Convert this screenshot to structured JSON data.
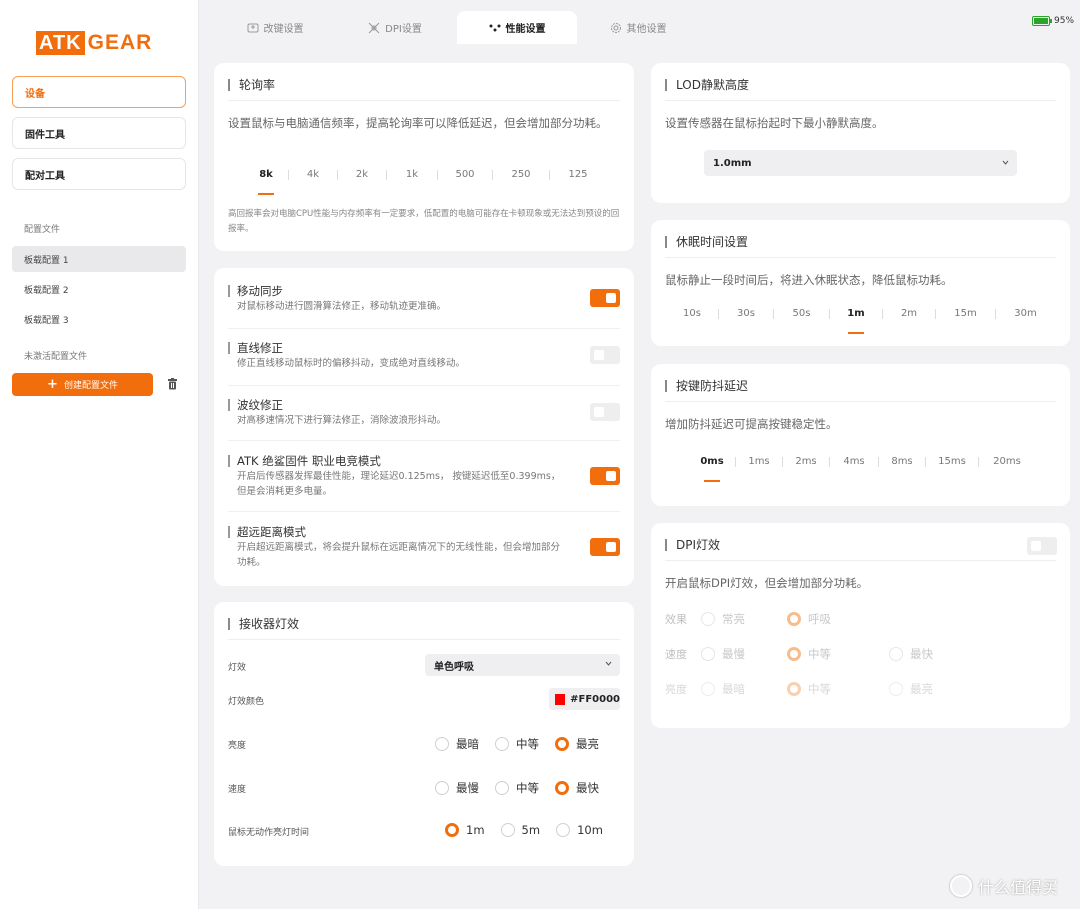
{
  "brand": {
    "logo_a": "ATK",
    "logo_b": "GEAR",
    "accent": "#f26d0c"
  },
  "sidebar": {
    "nav": [
      "设备",
      "固件工具",
      "配对工具"
    ],
    "config_section_label": "配置文件",
    "configs": [
      "板载配置 1",
      "板载配置 2",
      "板载配置 3"
    ],
    "inactive_label": "未激活配置文件",
    "create_label": "创建配置文件"
  },
  "tabs": [
    {
      "label": "改键设置",
      "icon": "keyboard-icon"
    },
    {
      "label": "DPI设置",
      "icon": "crosshair-icon"
    },
    {
      "label": "性能设置",
      "icon": "dots-icon"
    },
    {
      "label": "其他设置",
      "icon": "gear-icon"
    }
  ],
  "battery": {
    "level": "95%"
  },
  "polling": {
    "title": "轮询率",
    "desc": "设置鼠标与电脑通信频率，提高轮询率可以降低延迟，但会增加部分功耗。",
    "options": [
      "8k",
      "4k",
      "2k",
      "1k",
      "500",
      "250",
      "125"
    ],
    "selected": "8k",
    "note": "高回报率会对电脑CPU性能与内存频率有一定要求，低配置的电脑可能存在卡顿现象或无法达到预设的回报率。"
  },
  "toggles": {
    "motion_sync": {
      "title": "移动同步",
      "desc": "对鼠标移动进行圆滑算法修正，移动轨迹更准确。",
      "on": true
    },
    "angle_snap": {
      "title": "直线修正",
      "desc": "修正直线移动鼠标时的偏移抖动，变成绝对直线移动。",
      "on": false
    },
    "ripple": {
      "title": "波纹修正",
      "desc": "对高移速情况下进行算法修正，消除波浪形抖动。",
      "on": false
    },
    "pro_mode": {
      "title": "ATK 绝鲨固件 职业电竞模式",
      "desc": "开启后传感器发挥最佳性能，理论延迟0.125ms， 按键延迟低至0.399ms，但是会消耗更多电量。",
      "on": true
    },
    "long_range": {
      "title": "超远距离模式",
      "desc": "开启超远距离模式，将会提升鼠标在远距离情况下的无线性能，但会增加部分功耗。",
      "on": true
    }
  },
  "receiver": {
    "title": "接收器灯效",
    "effect_label": "灯效",
    "effect_value": "单色呼吸",
    "color_label": "灯效颜色",
    "color_value": "#FF0000",
    "brightness_label": "亮度",
    "brightness_options": [
      "最暗",
      "中等",
      "最亮"
    ],
    "brightness_selected": "最亮",
    "speed_label": "速度",
    "speed_options": [
      "最慢",
      "中等",
      "最快"
    ],
    "speed_selected": "最快",
    "idle_label": "鼠标无动作亮灯时间",
    "idle_options": [
      "1m",
      "5m",
      "10m"
    ],
    "idle_selected": "1m"
  },
  "lod": {
    "title": "LOD静默高度",
    "desc": "设置传感器在鼠标抬起时下最小静默高度。",
    "value": "1.0mm"
  },
  "sleep": {
    "title": "休眠时间设置",
    "desc": "鼠标静止一段时间后，将进入休眠状态，降低鼠标功耗。",
    "options": [
      "10s",
      "30s",
      "50s",
      "1m",
      "2m",
      "15m",
      "30m"
    ],
    "selected": "1m"
  },
  "debounce": {
    "title": "按键防抖延迟",
    "desc": "增加防抖延迟可提高按键稳定性。",
    "options": [
      "0ms",
      "1ms",
      "2ms",
      "4ms",
      "8ms",
      "15ms",
      "20ms"
    ],
    "selected": "0ms"
  },
  "dpi_light": {
    "title": "DPI灯效",
    "desc": "开启鼠标DPI灯效，但会增加部分功耗。",
    "on": false,
    "effect_label": "效果",
    "effect_options": [
      "常亮",
      "呼吸"
    ],
    "effect_selected": "呼吸",
    "speed_label": "速度",
    "speed_options": [
      "最慢",
      "中等",
      "最快"
    ],
    "speed_selected": "中等",
    "brightness_label": "亮度",
    "brightness_options": [
      "最暗",
      "中等",
      "最亮"
    ],
    "brightness_selected": "中等"
  },
  "watermark": "什么值得买"
}
